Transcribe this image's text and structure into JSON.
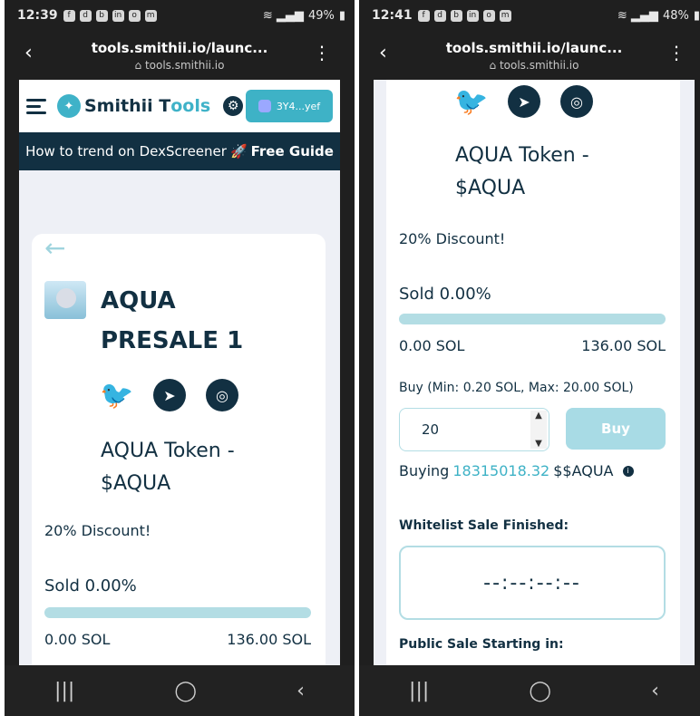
{
  "left": {
    "status": {
      "time": "12:39",
      "battery": "49%"
    },
    "browser": {
      "url": "tools.smithii.io/launc...",
      "domain": "tools.smithii.io"
    },
    "header": {
      "brand_a": "Smithii T",
      "brand_b": "ools",
      "wallet": "3Y4...yef"
    },
    "banner": {
      "text": "How to trend on DexScreener",
      "emoji": "🚀",
      "cta": "Free Guide"
    },
    "presale": {
      "title_line1": "AQUA",
      "title_line2": "PRESALE 1"
    },
    "token": {
      "name_line1": "AQUA Token -",
      "name_line2": "$AQUA"
    },
    "discount": "20% Discount!",
    "sold": "Sold 0.00%",
    "progress": 0.0,
    "sol_min": "0.00 SOL",
    "sol_max": "136.00 SOL"
  },
  "right": {
    "status": {
      "time": "12:41",
      "battery": "48%"
    },
    "browser": {
      "url": "tools.smithii.io/launc...",
      "domain": "tools.smithii.io"
    },
    "token": {
      "name_line1": "AQUA Token -",
      "name_line2": "$AQUA"
    },
    "discount": "20% Discount!",
    "sold": "Sold 0.00%",
    "progress": 0.0,
    "sol_min": "0.00 SOL",
    "sol_max": "136.00 SOL",
    "buy": {
      "label": "Buy",
      "range": "(Min: 0.20 SOL, Max: 20.00 SOL)",
      "quantity": "20",
      "button": "Buy"
    },
    "buying": {
      "prefix": "Buying",
      "amount": "18315018.32",
      "suffix": "$$AQUA"
    },
    "whitelist": {
      "label": "Whitelist Sale Finished:",
      "countdown": "--:--:--:--"
    },
    "public": {
      "label": "Public Sale Starting in:"
    }
  },
  "colors": {
    "primary": "#3eb2c6",
    "dark": "#123042",
    "track": "#b3dde4"
  }
}
